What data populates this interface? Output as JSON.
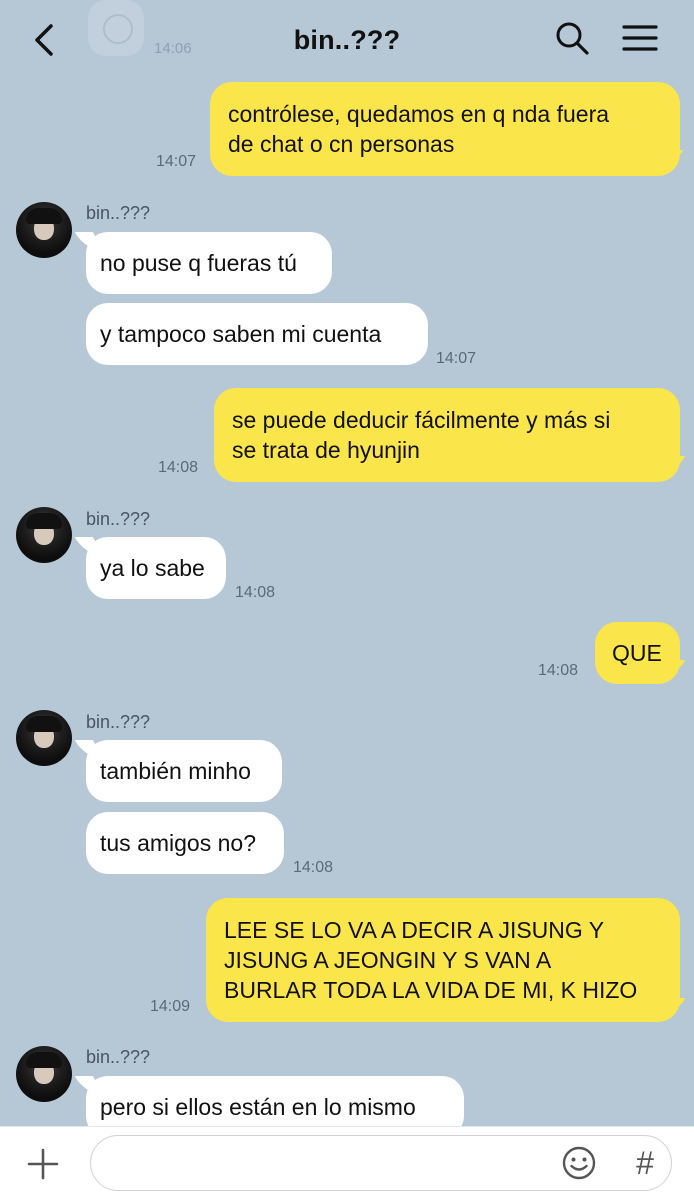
{
  "header": {
    "title": "bin..???",
    "ghost_time": "14:06"
  },
  "messages": [
    {
      "type": "out",
      "lines": [
        "contrólese, quedamos en q nda fuera",
        "de chat o cn personas"
      ],
      "time": "14:07"
    },
    {
      "type": "sender",
      "name": "bin..???"
    },
    {
      "type": "in",
      "text": "no puse q fueras tú"
    },
    {
      "type": "in",
      "text": "y tampoco saben mi cuenta",
      "time": "14:07"
    },
    {
      "type": "out",
      "lines": [
        "se puede deducir fácilmente y más si",
        "se trata de hyunjin"
      ],
      "time": "14:08"
    },
    {
      "type": "sender",
      "name": "bin..???"
    },
    {
      "type": "in",
      "text": "ya lo sabe",
      "time": "14:08"
    },
    {
      "type": "out",
      "lines": [
        "QUE"
      ],
      "time": "14:08"
    },
    {
      "type": "sender",
      "name": "bin..???"
    },
    {
      "type": "in",
      "text": "también minho"
    },
    {
      "type": "in",
      "text": "tus amigos no?",
      "time": "14:08"
    },
    {
      "type": "out",
      "lines": [
        "LEE SE LO VA A DECIR A JISUNG Y",
        "JISUNG A JEONGIN Y S VAN A",
        "BURLAR TODA LA VIDA DE MI, K HIZO"
      ],
      "time": "14:09"
    },
    {
      "type": "sender",
      "name": "bin..???"
    },
    {
      "type": "in",
      "text": "pero si ellos están en lo mismo"
    }
  ],
  "footer": {
    "input_placeholder": "",
    "hash_label": "#"
  },
  "colors": {
    "background": "#b6c7d6",
    "outgoing_bubble": "#fae54b",
    "incoming_bubble": "#ffffff"
  },
  "icons": [
    "back-icon",
    "search-icon",
    "menu-icon",
    "plus-icon",
    "emoji-icon",
    "hash-icon"
  ]
}
